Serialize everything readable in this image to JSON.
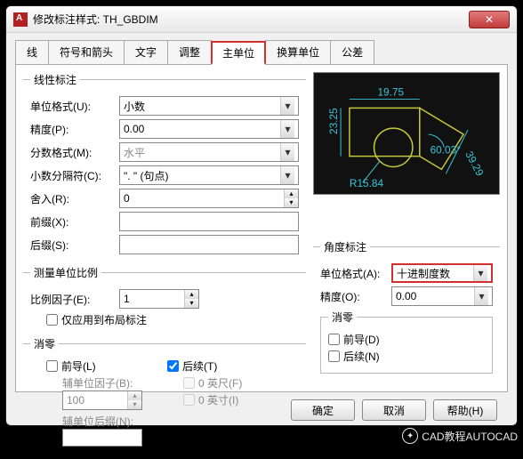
{
  "window": {
    "title": "修改标注样式: TH_GBDIM",
    "close": "✕"
  },
  "tabs": {
    "t0": "线",
    "t1": "符号和箭头",
    "t2": "文字",
    "t3": "调整",
    "t4": "主单位",
    "t5": "换算单位",
    "t6": "公差"
  },
  "linear": {
    "legend": "线性标注",
    "unitFmt_lbl": "单位格式(U):",
    "unitFmt_val": "小数",
    "prec_lbl": "精度(P):",
    "prec_val": "0.00",
    "frac_lbl": "分数格式(M):",
    "frac_val": "水平",
    "dsep_lbl": "小数分隔符(C):",
    "dsep_val": "\". \" (句点)",
    "round_lbl": "舍入(R):",
    "round_val": "0",
    "prefix_lbl": "前缀(X):",
    "prefix_val": "",
    "suffix_lbl": "后缀(S):",
    "suffix_val": ""
  },
  "scale": {
    "legend": "测量单位比例",
    "factor_lbl": "比例因子(E):",
    "factor_val": "1",
    "layoutOnly": "仅应用到布局标注"
  },
  "zero": {
    "legend": "消零",
    "leading": "前导(L)",
    "trailing": "后续(T)",
    "subFactor_lbl": "辅单位因子(B):",
    "subFactor_val": "100",
    "subSuffix_lbl": "辅单位后缀(N):",
    "subSuffix_val": "",
    "feet": "0 英尺(F)",
    "inch": "0 英寸(I)"
  },
  "ang": {
    "legend": "角度标注",
    "unitFmt_lbl": "单位格式(A):",
    "unitFmt_val": "十进制度数",
    "prec_lbl": "精度(O):",
    "prec_val": "0.00",
    "zero_legend": "消零",
    "leading": "前导(D)",
    "trailing": "后续(N)"
  },
  "preview_dims": {
    "top": "19.75",
    "left": "23.25",
    "r": "R15.84",
    "ang": "60.03°",
    "diag": "39.29"
  },
  "buttons": {
    "ok": "确定",
    "cancel": "取消",
    "help": "帮助(H)"
  },
  "watermark": "CAD教程AUTOCAD"
}
